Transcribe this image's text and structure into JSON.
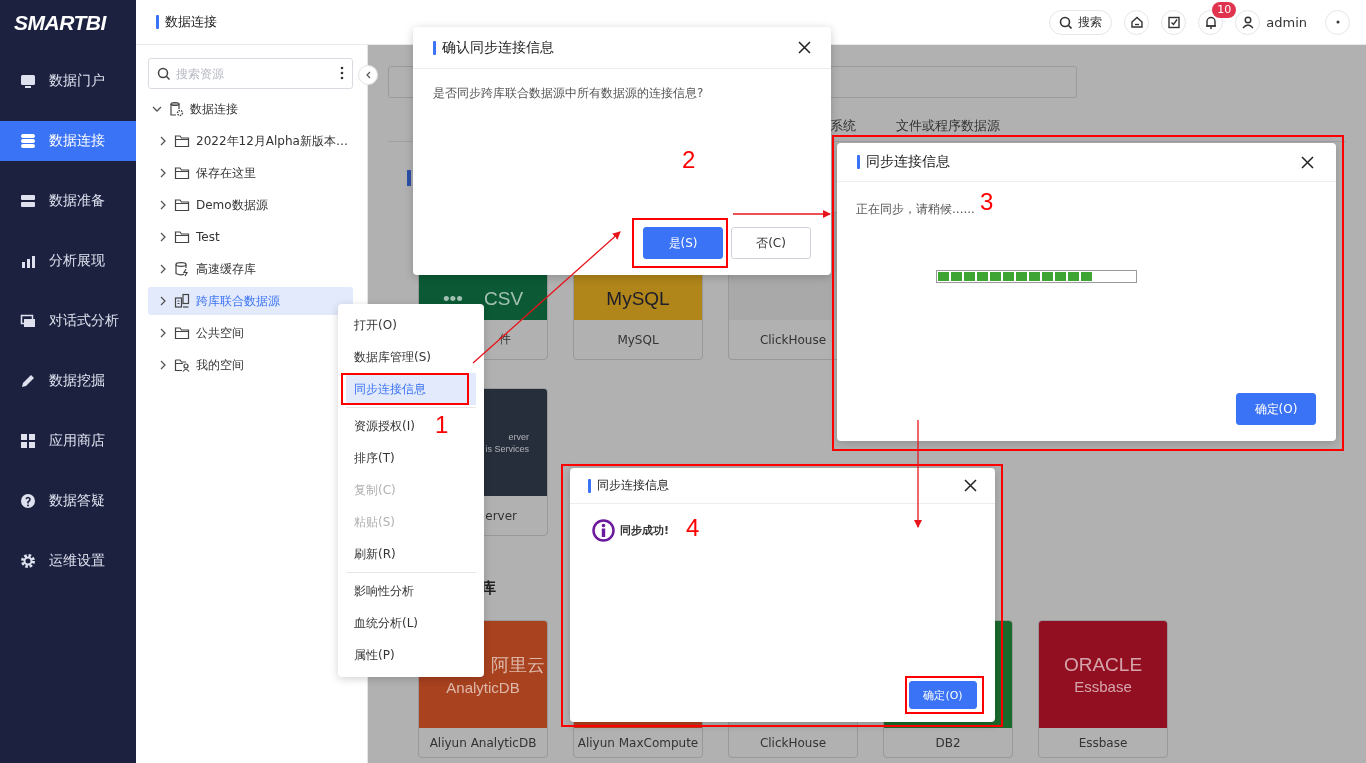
{
  "sidebar": {
    "logo": "SMARTBI",
    "items": [
      {
        "label": "数据门户",
        "selected": false
      },
      {
        "label": "数据连接",
        "selected": true
      },
      {
        "label": "数据准备",
        "selected": false
      },
      {
        "label": "分析展现",
        "selected": false
      },
      {
        "label": "对话式分析",
        "selected": false
      },
      {
        "label": "数据挖掘",
        "selected": false
      },
      {
        "label": "应用商店",
        "selected": false
      },
      {
        "label": "数据答疑",
        "selected": false
      },
      {
        "label": "运维设置",
        "selected": false
      }
    ]
  },
  "header": {
    "title": "数据连接",
    "search": "搜索",
    "notification_count": "10",
    "user": "admin"
  },
  "resource_panel": {
    "search": {
      "placeholder": "搜索资源"
    },
    "tree": [
      {
        "label": "数据连接",
        "kind": "connection",
        "expanded": true,
        "selected": false,
        "children": [
          {
            "label": "2022年12月Alpha新版本…",
            "kind": "folder",
            "expanded": false,
            "selected": false
          },
          {
            "label": "保存在这里",
            "kind": "folder",
            "expanded": false,
            "selected": false
          },
          {
            "label": "Demo数据源",
            "kind": "folder",
            "expanded": false,
            "selected": false
          },
          {
            "label": "Test",
            "kind": "folder",
            "expanded": false,
            "selected": false
          },
          {
            "label": "高速缓存库",
            "kind": "cache",
            "expanded": false,
            "selected": false
          },
          {
            "label": "跨库联合数据源",
            "kind": "federated",
            "expanded": false,
            "selected": true
          },
          {
            "label": "公共空间",
            "kind": "folder",
            "expanded": false,
            "selected": false
          },
          {
            "label": "我的空间",
            "kind": "user-folder",
            "expanded": false,
            "selected": false
          }
        ]
      }
    ]
  },
  "main": {
    "tabs": [
      {
        "label": "系统",
        "selected": false
      },
      {
        "label": "文件或程序数据源",
        "selected": false
      }
    ],
    "sections": [
      {
        "rows": [
          [
            {
              "kind": "text",
              "color": "#0b5a35",
              "logo": [
                "•••    CSV"
              ],
              "label": "件"
            },
            {
              "kind": "text",
              "color": "#b0861a",
              "logo": [
                "MySQL"
              ],
              "label": "MySQL"
            },
            {
              "kind": "bars",
              "color": "#a9a9a9",
              "label": "ClickHouse"
            }
          ],
          [
            {
              "kind": "text",
              "color": "#272e3b",
              "logo": [
                "erver",
                "is Services"
              ],
              "label": "erver"
            }
          ]
        ]
      },
      {
        "title": "库",
        "rows": [
          [
            {
              "kind": "text",
              "color": "#a8421f",
              "logo": [
                "阿里云",
                "AnalyticDB"
              ],
              "label": "Aliyun AnalyticDB"
            },
            {
              "kind": "blank",
              "color": "#b3401f",
              "label": "Aliyun MaxCompute"
            },
            {
              "kind": "blank",
              "color": "#a9a9a9",
              "label": "ClickHouse"
            },
            {
              "kind": "blank",
              "color": "#1b6a2d",
              "label": "DB2"
            },
            {
              "kind": "text",
              "color": "#920f21",
              "logo": [
                "ORACLE",
                "Essbase"
              ],
              "label": "Essbase"
            }
          ]
        ]
      }
    ]
  },
  "context_menu": {
    "items": [
      {
        "kind": "item",
        "label": "打开(O)",
        "disabled": false,
        "selected": false
      },
      {
        "kind": "item",
        "label": "数据库管理(S)",
        "disabled": false,
        "selected": false
      },
      {
        "kind": "item",
        "label": "同步连接信息",
        "disabled": false,
        "selected": true
      },
      {
        "kind": "divider"
      },
      {
        "kind": "item",
        "label": "资源授权(I)",
        "disabled": false,
        "selected": false
      },
      {
        "kind": "item",
        "label": "排序(T)",
        "disabled": false,
        "selected": false
      },
      {
        "kind": "item",
        "label": "复制(C)",
        "disabled": true,
        "selected": false
      },
      {
        "kind": "item",
        "label": "粘贴(S)",
        "disabled": true,
        "selected": false
      },
      {
        "kind": "item",
        "label": "刷新(R)",
        "disabled": false,
        "selected": false
      },
      {
        "kind": "divider"
      },
      {
        "kind": "item",
        "label": "影响性分析",
        "disabled": false,
        "selected": false
      },
      {
        "kind": "item",
        "label": "血统分析(L)",
        "disabled": false,
        "selected": false
      },
      {
        "kind": "item",
        "label": "属性(P)",
        "disabled": false,
        "selected": false
      }
    ]
  },
  "dialogs": [
    {
      "kind": "confirm",
      "title": "确认同步连接信息",
      "message": "是否同步跨库联合数据源中所有数据源的连接信息?",
      "buttons": [
        {
          "label": "是(S)",
          "primary": true
        },
        {
          "label": "否(C)",
          "primary": false
        }
      ]
    },
    {
      "kind": "progress",
      "title": "同步连接信息",
      "message": "正在同步，请稍候......",
      "level": 0.79,
      "buttons": [
        {
          "label": "确定(O)",
          "primary": true
        }
      ]
    },
    {
      "kind": "info",
      "title": "同步连接信息",
      "message": "同步成功!",
      "buttons": [
        {
          "label": "确定(O)",
          "primary": true
        }
      ]
    }
  ],
  "annotations": [
    "1",
    "2",
    "3",
    "4"
  ]
}
